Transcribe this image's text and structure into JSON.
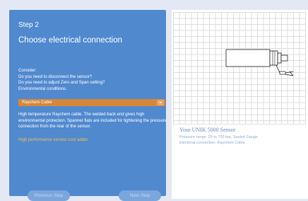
{
  "wizard": {
    "step_label": "Step 2",
    "step_title": "Choose electrical connection",
    "consider_lines": [
      "Consider:",
      "Do you need to disconnect the sensor?",
      "Do you need to adjust Zero and Span setting?",
      "Environmental conditions."
    ],
    "select": {
      "value": "Raychem Cable"
    },
    "description": "High temperature Raychem cable. The welded back end gives high environmental protection. Spanner flats are included for tightening the pressure connection from the rear of the sensor.",
    "note": "High performance version cost adder.",
    "buttons": {
      "previous": "Previous Step",
      "next": "Next Step"
    }
  },
  "product": {
    "name": "Your UNIK 5000 Sensor",
    "pressure_range": "Pressure range: 20 to 700 bar, Sealed Gauge",
    "electrical_connection": "Electrical connection: Raychem Cable"
  },
  "colors": {
    "panel": "#5189cf",
    "select": "#d5873a",
    "note": "#f2c24c",
    "button": "#7aa6dc"
  }
}
